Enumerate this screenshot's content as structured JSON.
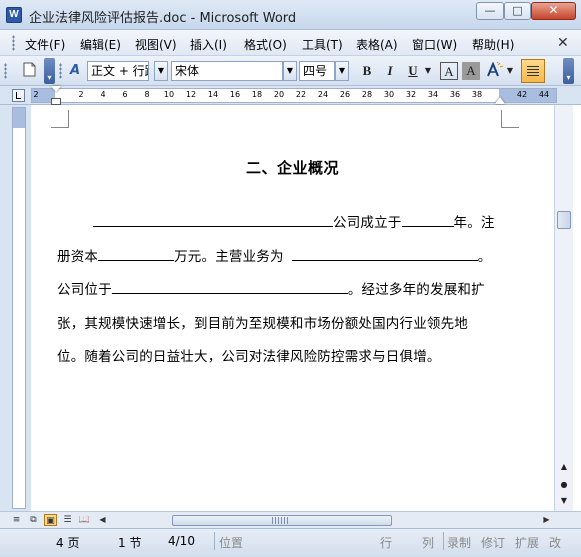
{
  "window": {
    "title": "企业法律风险评估报告.doc - Microsoft Word",
    "app_icon_letter": "W",
    "minimize_glyph": "—",
    "maximize_glyph": "□",
    "close_glyph": "✕"
  },
  "menubar": {
    "items": [
      "文件(F)",
      "编辑(E)",
      "视图(V)",
      "插入(I)",
      "格式(O)",
      "工具(T)",
      "表格(A)",
      "窗口(W)",
      "帮助(H)"
    ],
    "close_glyph": "✕"
  },
  "toolbar": {
    "style_value": "正文 + 行距",
    "font_value": "宋体",
    "size_value": "四号",
    "bold": "B",
    "italic": "I",
    "underline": "U",
    "font_color_glyph": "A",
    "char_shading_glyph": "A",
    "styles_glyph": "A"
  },
  "ruler": {
    "ticks": [
      "2",
      "2",
      "4",
      "6",
      "8",
      "10",
      "12",
      "14",
      "16",
      "18",
      "20",
      "22",
      "24",
      "26",
      "28",
      "30",
      "32",
      "34",
      "36",
      "38",
      "42",
      "44"
    ]
  },
  "document": {
    "heading": "二、企业概况",
    "paragraph": {
      "line1_text": "公司成立于",
      "line1_year": "年。注",
      "line2_a": "册资本",
      "line2_b": "万元。主营业务为",
      "line2_c": "。",
      "line3_a": "公司位于",
      "line3_b": "。经过多年的发展和扩",
      "line4": "张，其规模快速增长，到目前为至规模和市场份额处国内行业领先地",
      "line5": "位。随着公司的日益壮大，公司对法律风险防控需求与日俱增。"
    }
  },
  "status": {
    "page": "4 页",
    "section": "1 节",
    "page_of": "4/10",
    "position": "位置",
    "line": "行",
    "column": "列",
    "record": "录制",
    "revise": "修订",
    "extend": "扩展",
    "overtype": "改"
  }
}
